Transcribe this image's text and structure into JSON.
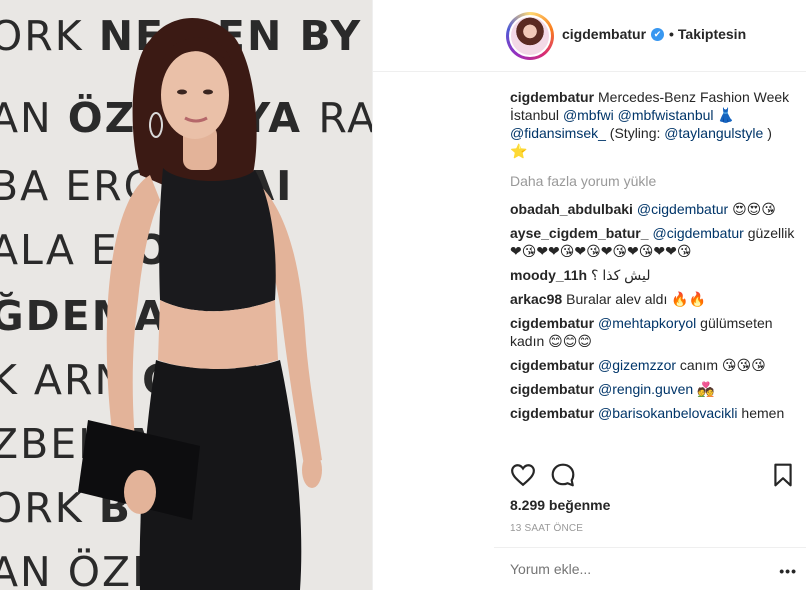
{
  "photo": {
    "backdrop": [
      {
        "text": "ORK  NEW GEN BY",
        "style": "mixed"
      },
      {
        "text": "AN ÖZLEM  AYA RA",
        "style": "mixed"
      },
      {
        "text": "BA ERG  ANAN",
        "style": "mixed"
      },
      {
        "text": "ALA  E  ORÇA",
        "style": "mixed"
      },
      {
        "text": "ĞDEMA  BER",
        "style": "mixed"
      },
      {
        "text": "K ARN  ON S",
        "style": "mixed"
      },
      {
        "text": "ZBEK  ANAN",
        "style": "mixed"
      },
      {
        "text": "ORK  BY",
        "style": "mixed"
      },
      {
        "text": "AN ÖZLE  RAS",
        "style": "mixed"
      }
    ]
  },
  "header": {
    "username": "cigdembatur",
    "verified_icon": "✔",
    "separator": "•",
    "follow_state": "Takiptesin"
  },
  "caption": {
    "user": "cigdembatur",
    "text_1": "Mercedes-Benz Fashion Week İstanbul ",
    "mention_1": "@mbfwi",
    "mention_2": "@mbfwistanbul",
    "emoji_1": "👗",
    "mention_3": "@fidansimsek_",
    "text_2": " (Styling: ",
    "mention_4": "@taylangulstyle",
    "text_3": " )",
    "emoji_2": "⭐"
  },
  "load_more": "Daha fazla yorum yükle",
  "comments": [
    {
      "user": "obadah_abdulbaki",
      "mention": "@cigdembatur",
      "text": "😍😍😘"
    },
    {
      "user": "ayse_cigdem_batur_",
      "mention": "@cigdembatur",
      "text": "güzellik ❤😘❤❤😘❤😘❤😘❤😘❤❤😘"
    },
    {
      "user": "moody_11h",
      "mention": "",
      "text": "ليش كذا ؟"
    },
    {
      "user": "arkac98",
      "mention": "",
      "text": "Buralar alev aldı 🔥🔥"
    },
    {
      "user": "cigdembatur",
      "mention": "@mehtapkoryol",
      "text": "gülümseten kadın 😊😊😊"
    },
    {
      "user": "cigdembatur",
      "mention": "@gizemzzor",
      "text": "canım 😘😘😘"
    },
    {
      "user": "cigdembatur",
      "mention": "@rengin.guven",
      "text": "💑"
    },
    {
      "user": "cigdembatur",
      "mention": "@barisokanbelovacikli",
      "text": "hemen"
    }
  ],
  "actions": {
    "like_icon": "heart-icon",
    "comment_icon": "comment-icon"
  },
  "likes": "8.299 beğenme",
  "time": "13 SAAT ÖNCE",
  "add_comment": {
    "placeholder": "Yorum ekle...",
    "more_label": "•••"
  }
}
